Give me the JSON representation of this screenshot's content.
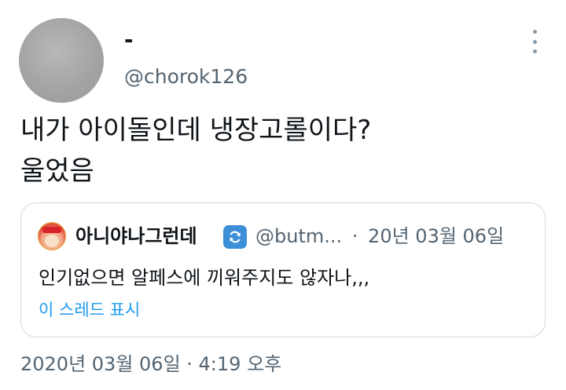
{
  "author": {
    "display_name": "-",
    "handle": "@chorok126"
  },
  "tweet": {
    "lines": [
      "내가 아이돌인데 냉장고롤이다?",
      "울었음"
    ]
  },
  "quoted_tweet": {
    "name": "아니야나그런데",
    "handle": "@butm...",
    "separator": "·",
    "date": "20년 03월 06일",
    "text": "인기없으면 알페스에 끼워주지도 않자나,,,",
    "show_thread_label": "이 스레드 표시"
  },
  "timestamp": "2020년 03월 06일 · 4:19 오후",
  "icons": {
    "more": "more-vertical-icon",
    "verified": "refresh-badge-icon"
  },
  "colors": {
    "text": "#0f1419",
    "secondary": "#536471",
    "link": "#1d9bf0",
    "border": "#cfd9de",
    "badge": "#3d8fd8"
  }
}
